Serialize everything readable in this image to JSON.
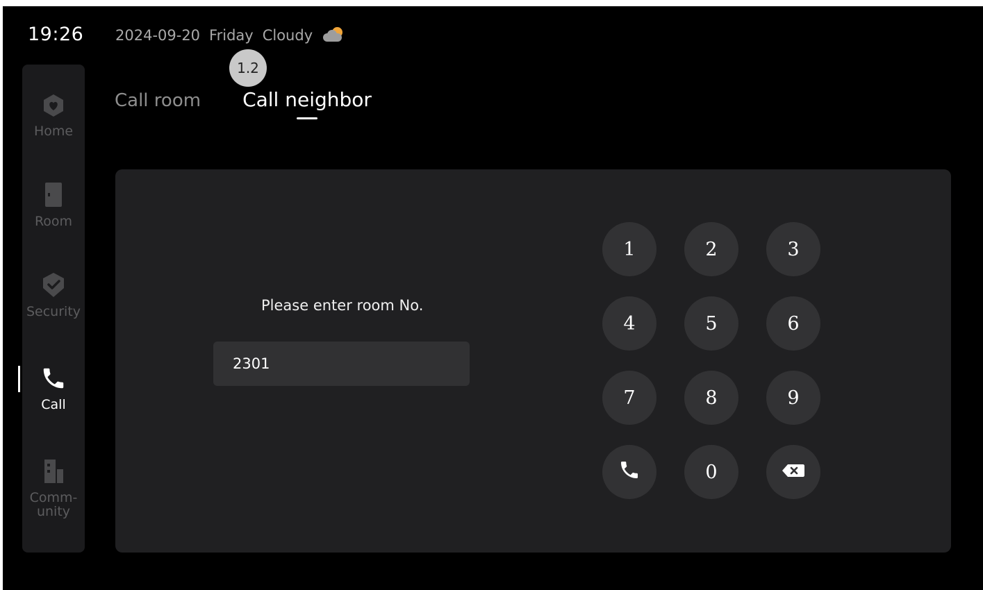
{
  "status": {
    "time": "19:26",
    "date": "2024-09-20",
    "weekday": "Friday",
    "weather": "Cloudy",
    "weather_icon": "partly-cloudy-icon"
  },
  "step_badge": "1.2",
  "tabs": [
    {
      "label": "Call room",
      "active": false
    },
    {
      "label": "Call neighbor",
      "active": true
    }
  ],
  "sidebar": {
    "items": [
      {
        "label": "Home",
        "icon": "home-icon",
        "active": false
      },
      {
        "label": "Room",
        "icon": "door-icon",
        "active": false
      },
      {
        "label": "Security",
        "icon": "shield-check-icon",
        "active": false
      },
      {
        "label": "Call",
        "icon": "phone-icon",
        "active": true
      },
      {
        "label": "Comm-unity",
        "label_line1": "Comm-",
        "label_line2": "unity",
        "icon": "building-icon",
        "active": false
      }
    ]
  },
  "dialer": {
    "prompt": "Please enter room No.",
    "room_number": "2301",
    "keys": [
      "1",
      "2",
      "3",
      "4",
      "5",
      "6",
      "7",
      "8",
      "9",
      "0"
    ],
    "call_icon": "phone-icon",
    "backspace_icon": "backspace-icon"
  },
  "colors": {
    "background": "#000000",
    "sidebar": "#1b1b1d",
    "panel": "#202022",
    "key": "#323234",
    "input": "#313133",
    "muted_text": "#8e8e8e",
    "inactive_nav": "#5c5c5e",
    "weather_sun": "#f0a53a"
  }
}
